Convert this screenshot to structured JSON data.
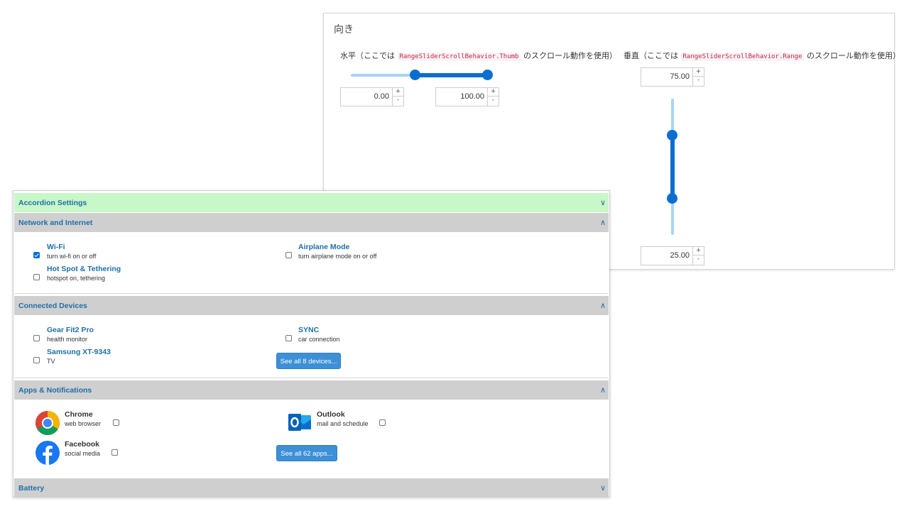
{
  "orientation": {
    "title": "向き",
    "horizontal": {
      "label_prefix": "水平（ここでは",
      "code": "RangeSliderScrollBehavior.Thumb",
      "label_suffix": "のスクロール動作を使用）",
      "lower_value": "0.00",
      "upper_value": "100.00",
      "range_min": 0,
      "range_max": 100,
      "lower": 0.45,
      "upper": 1.0
    },
    "vertical": {
      "label_prefix": "垂直（ここでは",
      "code": "RangeSliderScrollBehavior.Range",
      "label_suffix": "のスクロール動作を使用）",
      "upper_value": "75.00",
      "lower_value": "25.00",
      "range_min": 0,
      "range_max": 100,
      "upper": 0.75,
      "lower": 0.25
    },
    "spin_up": "+",
    "spin_down": "-"
  },
  "accordion": {
    "settings_header": "Accordion Settings",
    "sections": {
      "network": {
        "header": "Network and Internet",
        "items": [
          {
            "title": "Wi-Fi",
            "subtitle": "turn wi-fi on or off",
            "checked": true
          },
          {
            "title": "Airplane Mode",
            "subtitle": "turn airplane mode on or off",
            "checked": false
          },
          {
            "title": "Hot Spot & Tethering",
            "subtitle": "hotspot on, tethering",
            "checked": false
          }
        ]
      },
      "devices": {
        "header": "Connected Devices",
        "items": [
          {
            "title": "Gear Fit2 Pro",
            "subtitle": "health monitor",
            "checked": false
          },
          {
            "title": "SYNC",
            "subtitle": "car connection",
            "checked": false
          },
          {
            "title": "Samsung XT-9343",
            "subtitle": "TV",
            "checked": false
          }
        ],
        "see_all": "See all 8 devices..."
      },
      "apps": {
        "header": "Apps & Notifications",
        "items": [
          {
            "title": "Chrome",
            "subtitle": "web browser",
            "icon": "chrome-icon",
            "checked": false
          },
          {
            "title": "Outlook",
            "subtitle": "mail and schedule",
            "icon": "outlook-icon",
            "checked": false
          },
          {
            "title": "Facebook",
            "subtitle": "social media",
            "icon": "facebook-icon",
            "checked": false
          }
        ],
        "see_all": "See all 62 apps..."
      },
      "battery": {
        "header": "Battery"
      }
    }
  },
  "colors": {
    "accent": "#0a6ed1",
    "track": "#a9d3f5",
    "header_bg": "#cfcfcf",
    "settings_bg": "#c8f7c8",
    "title_text": "#1d6fa8"
  }
}
